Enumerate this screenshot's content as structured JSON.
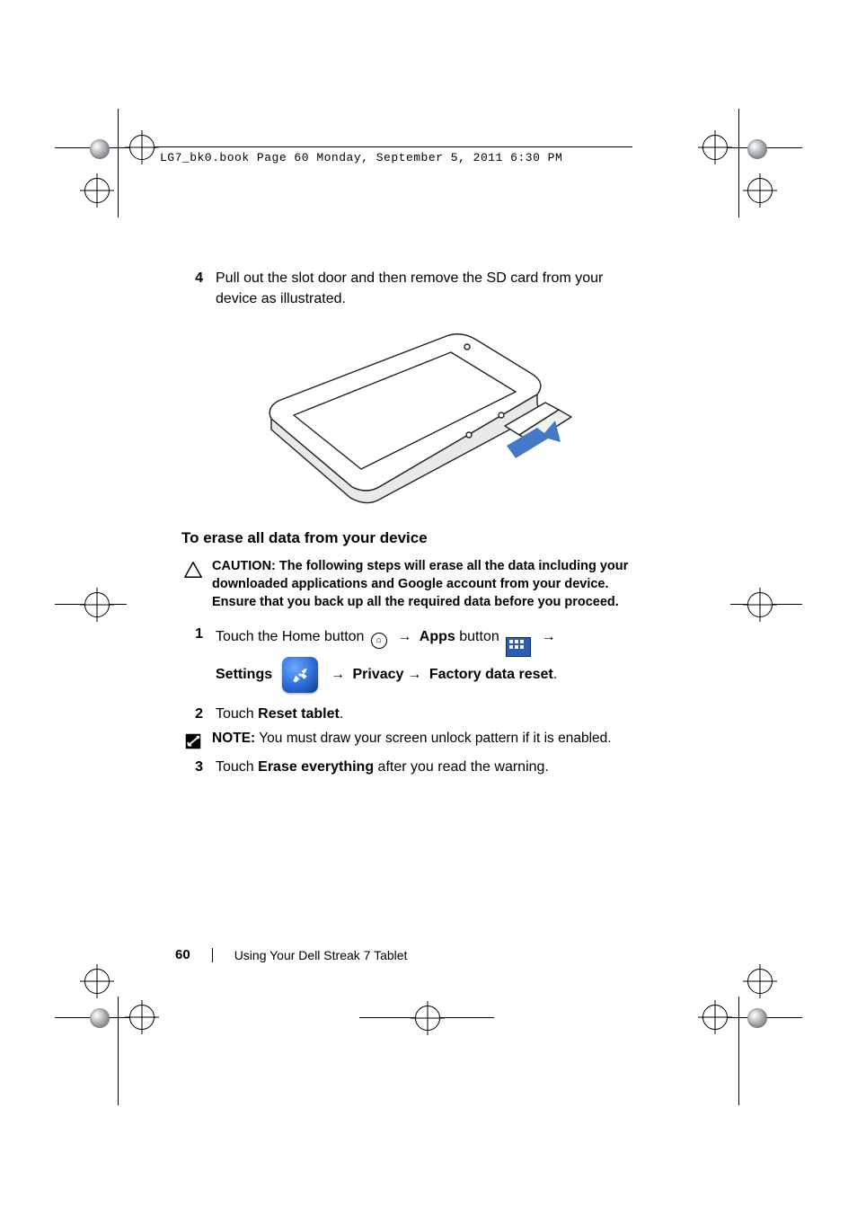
{
  "header": {
    "file_line": "LG7_bk0.book  Page 60  Monday, September 5, 2011  6:30 PM"
  },
  "step4": {
    "num": "4",
    "text": "Pull out the slot door and then remove the SD card from your device as illustrated."
  },
  "section_heading": "To erase all data from your device",
  "caution": {
    "label": "CAUTION:",
    "text": "The following steps will erase all the data including your downloaded applications and Google account from your device. Ensure that you back up all the required data before you proceed."
  },
  "step1": {
    "num": "1",
    "touch_home_prefix": "Touch the Home button ",
    "apps_label": "Apps",
    "button_word_after_apps": " button ",
    "settings_label": "Settings",
    "privacy_label": "Privacy",
    "factory_reset_label": "Factory data reset",
    "arrow": "→",
    "period": "."
  },
  "step2": {
    "num": "2",
    "prefix": "Touch ",
    "bold": "Reset tablet",
    "suffix": "."
  },
  "note": {
    "label": "NOTE:",
    "text": "You must draw your screen unlock pattern if it is enabled."
  },
  "step3": {
    "num": "3",
    "prefix": "Touch ",
    "bold": "Erase everything",
    "suffix": " after you read the warning."
  },
  "footer": {
    "page_number": "60",
    "chapter": "Using Your Dell Streak 7 Tablet"
  }
}
